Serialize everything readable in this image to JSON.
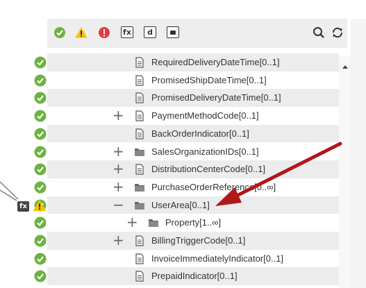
{
  "toolbar": {
    "fx_label": "fx",
    "d_label": "d",
    "icons": [
      "valid-filter-icon",
      "warning-filter-icon",
      "error-filter-icon",
      "function-icon",
      "d-icon",
      "comment-icon",
      "search-icon",
      "refresh-icon"
    ]
  },
  "rows": [
    {
      "label": "RequiredDeliveryDateTime[0..1]",
      "expander": "",
      "type": "field"
    },
    {
      "label": "PromisedShipDateTime[0..1]",
      "expander": "",
      "type": "field"
    },
    {
      "label": "PromisedDeliveryDateTime[0..1]",
      "expander": "",
      "type": "field"
    },
    {
      "label": "PaymentMethodCode[0..1]",
      "expander": "+",
      "type": "field"
    },
    {
      "label": "BackOrderIndicator[0..1]",
      "expander": "",
      "type": "field"
    },
    {
      "label": "SalesOrganizationIDs[0..1]",
      "expander": "+",
      "type": "folder"
    },
    {
      "label": "DistributionCenterCode[0..1]",
      "expander": "+",
      "type": "field"
    },
    {
      "label": "PurchaseOrderReference[0..∞]",
      "expander": "+",
      "type": "folder"
    },
    {
      "label": "UserArea[0..1]",
      "expander": "−",
      "type": "folder"
    },
    {
      "label": "Property[1..∞]",
      "expander": "+",
      "type": "folder",
      "indent": true
    },
    {
      "label": "BillingTriggerCode[0..1]",
      "expander": "+",
      "type": "field"
    },
    {
      "label": "InvoiceImmediatelyIndicator[0..1]",
      "expander": "",
      "type": "field"
    },
    {
      "label": "PrepaidIndicator[0..1]",
      "expander": "",
      "type": "field"
    }
  ],
  "mapping_badges": {
    "fx_label": "fx"
  },
  "colors": {
    "valid": "#6db33f",
    "warning": "#f2c200",
    "error": "#e03c3c",
    "arrow": "#b01818"
  }
}
